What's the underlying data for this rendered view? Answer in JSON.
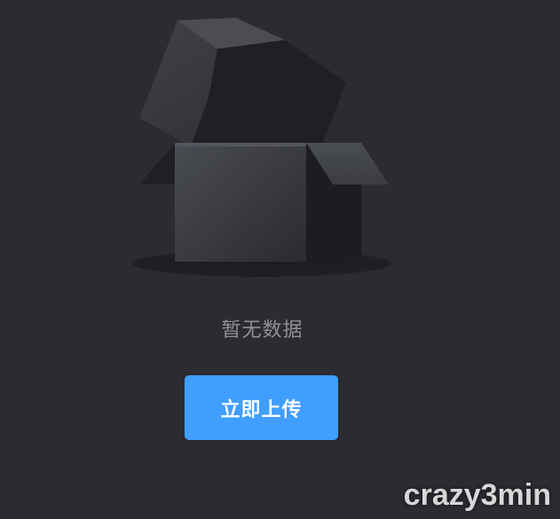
{
  "empty_state": {
    "message": "暂无数据",
    "illustration_icon": "empty-box-icon"
  },
  "upload_button": {
    "label": "立即上传",
    "color": "#409eff"
  },
  "watermark": {
    "text": "crazy3min"
  },
  "colors": {
    "background": "#2b2b30",
    "text_muted": "#8e9097"
  }
}
